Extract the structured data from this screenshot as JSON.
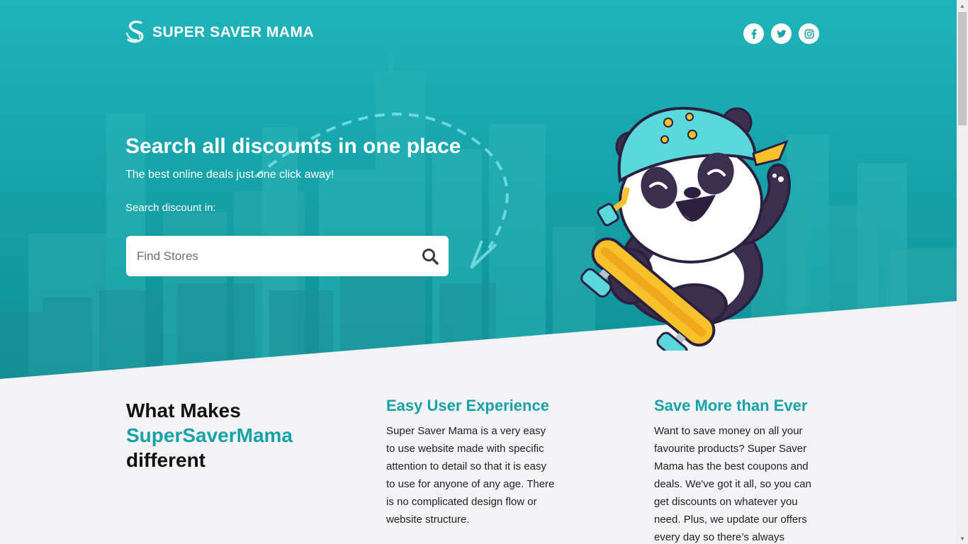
{
  "brand": {
    "name": "SUPER SAVER MAMA"
  },
  "social": [
    {
      "name": "facebook",
      "icon": "facebook-icon"
    },
    {
      "name": "twitter",
      "icon": "twitter-icon"
    },
    {
      "name": "instagram",
      "icon": "instagram-icon"
    }
  ],
  "hero": {
    "title": "Search all discounts in one place",
    "subtitle": "The best online deals just one click away!",
    "search_label": "Search discount in:",
    "search_placeholder": "Find Stores"
  },
  "features": {
    "heading_line1": "What Makes",
    "heading_accent": "SuperSaverMama",
    "heading_line3": "different",
    "columns": [
      {
        "title": "Easy User Experience",
        "text": "Super Saver Mama is a very easy to use website made with specific attention to detail so that it is easy to use for anyone of any age. There is no complicated design flow or website structure."
      },
      {
        "title": "Save More than Ever",
        "text": "Want to save money on all your favourite products? Super Saver Mama has the best coupons and deals. We've got it all, so you can get discounts on whatever you need. Plus, we update our offers every day so there’s always"
      }
    ]
  },
  "colors": {
    "accent": "#17a2a8",
    "hero_top": "#1fb6bd",
    "hero_bottom": "#0e959c",
    "panda_helmet": "#5ad8db",
    "skateboard": "#f7c12b"
  }
}
